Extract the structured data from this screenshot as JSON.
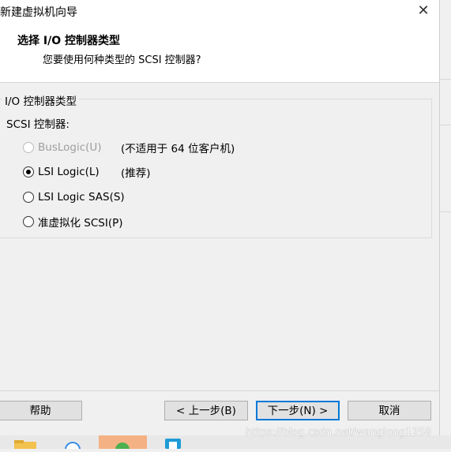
{
  "window": {
    "title": "新建虚拟机向导",
    "close_glyph": "✕"
  },
  "header": {
    "title": "选择 I/O 控制器类型",
    "subtitle": "您要使用何种类型的 SCSI 控制器?"
  },
  "group": {
    "legend": "I/O 控制器类型",
    "sublabel": "SCSI 控制器:",
    "options": [
      {
        "label": "BusLogic(U)",
        "note": "(不适用于 64 位客户机)",
        "checked": false,
        "disabled": true
      },
      {
        "label": "LSI Logic(L)",
        "note": "(推荐)",
        "checked": true,
        "disabled": false
      },
      {
        "label": "LSI Logic SAS(S)",
        "note": "",
        "checked": false,
        "disabled": false
      },
      {
        "label": "准虚拟化 SCSI(P)",
        "note": "",
        "checked": false,
        "disabled": false
      }
    ]
  },
  "buttons": {
    "help": "帮助",
    "back": "< 上一步(B)",
    "next": "下一步(N) >",
    "cancel": "取消"
  },
  "watermark": "https://blog.csdn.net/wanglong1258",
  "colors": {
    "accent": "#0078d7",
    "taskbar_orange": "#f4b183",
    "taskbar_blue": "#1d9bd7"
  }
}
